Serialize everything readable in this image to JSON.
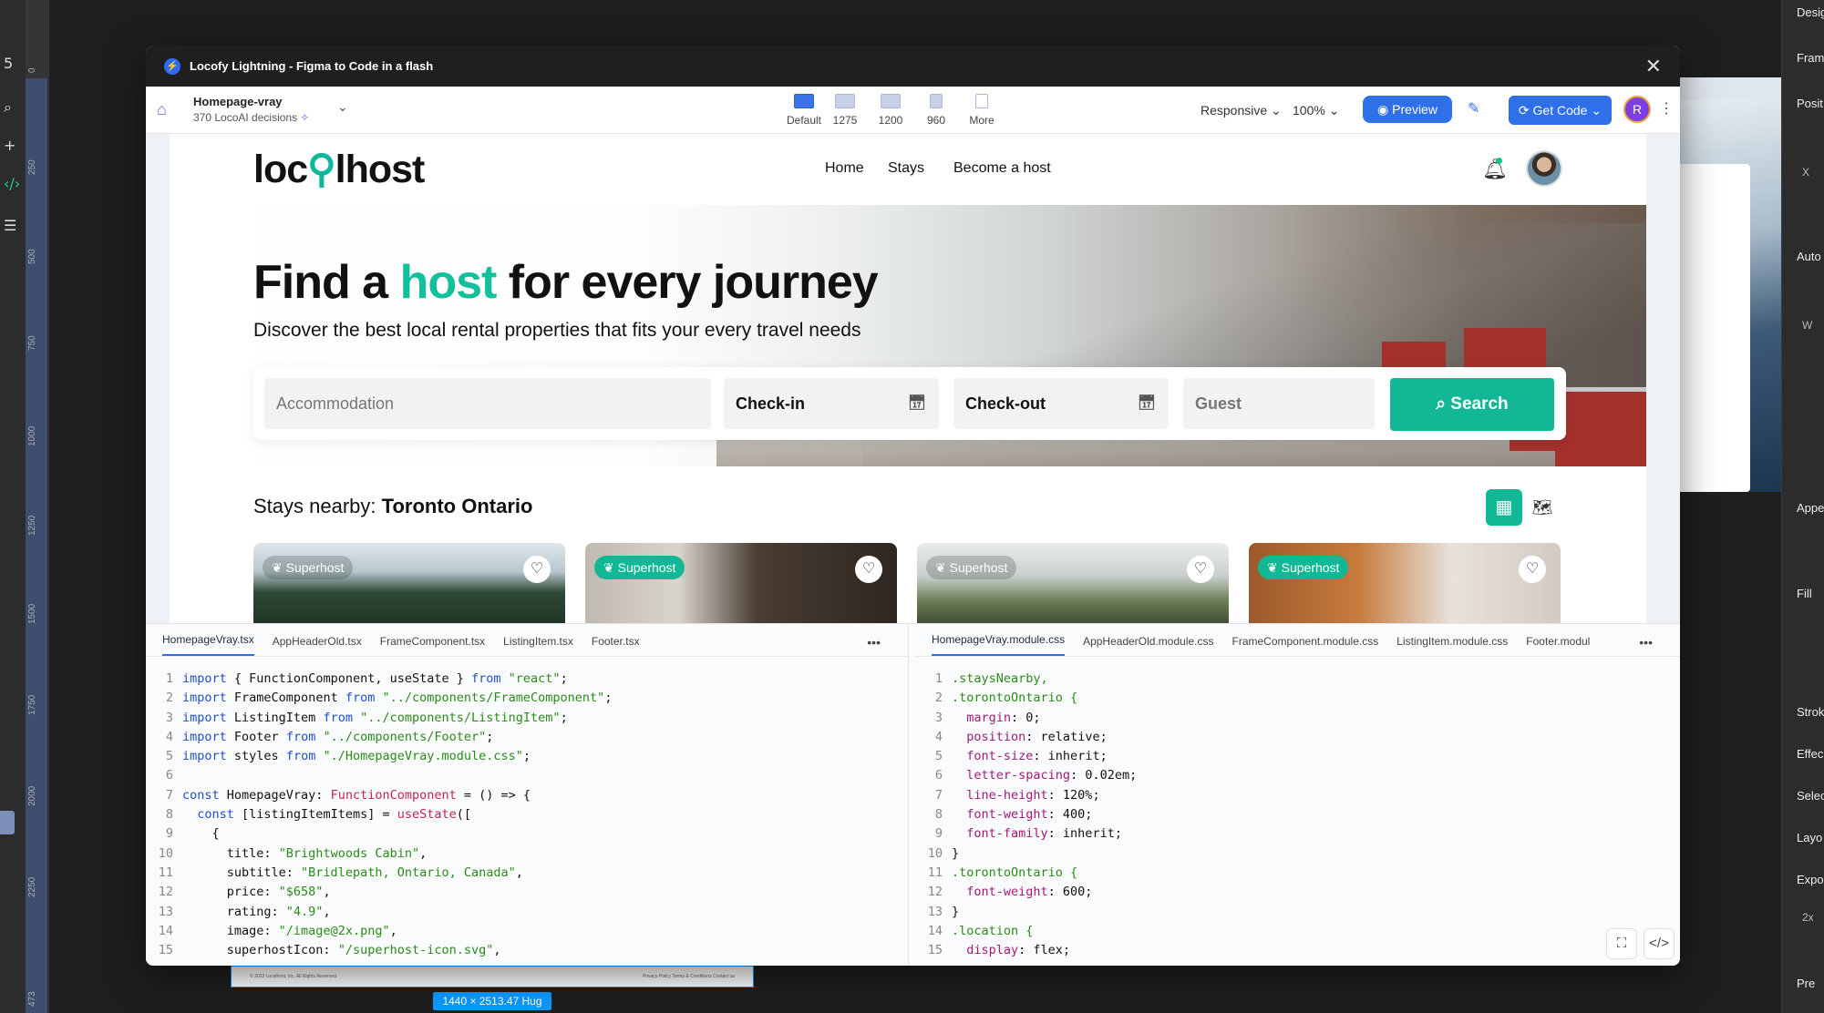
{
  "figma": {
    "ruler_marks": [
      "5",
      "0",
      "250",
      "500",
      "750",
      "1000",
      "1250",
      "1500",
      "1750",
      "2000",
      "2250",
      "473"
    ],
    "right_panel_labels": [
      "Desig",
      "Fram",
      "Posit",
      "Auto",
      "Appe",
      "Fill",
      "Strok",
      "Effec",
      "Selec",
      "Layo",
      "Expo",
      "Pre"
    ],
    "right_panel_values": [
      "X",
      "W",
      "2x"
    ],
    "frame_size": "1440 × 2513.47 Hug",
    "frame_footer_left": "© 2023 Localhost, Inc. All Rights Reserved",
    "frame_footer_links": "Privacy Policy   Terms & Conditions   Contact us"
  },
  "window": {
    "title": "Locofy Lightning - Figma to Code in a flash",
    "close_glyph": "✕"
  },
  "toolbar": {
    "project_name": "Homepage-vray",
    "project_sub": "370 LocoAI decisions",
    "breakpoints": [
      {
        "label": "Default",
        "active": true
      },
      {
        "label": "1275",
        "active": false
      },
      {
        "label": "1200",
        "active": false
      },
      {
        "label": "960",
        "active": false
      },
      {
        "label": "More",
        "active": false
      }
    ],
    "responsive_label": "Responsive",
    "zoom_label": "100%",
    "preview_label": "Preview",
    "get_code_label": "Get Code",
    "avatar_letter": "R",
    "accent_color": "#2f6fe9"
  },
  "site": {
    "logo_pre": "loc",
    "logo_post": "lhost",
    "nav": [
      "Home",
      "Stays",
      "Become a host"
    ],
    "hero_title_a": "Find a ",
    "hero_title_accent": "host",
    "hero_title_b": " for every journey",
    "hero_subtitle": "Discover the best local rental properties that fits your every travel needs",
    "search": {
      "accommodation_placeholder": "Accommodation",
      "checkin_label": "Check-in",
      "checkout_label": "Check-out",
      "guest_placeholder": "Guest",
      "button_label": "Search"
    },
    "stays_prefix": "Stays nearby: ",
    "stays_location": "Toronto Ontario",
    "badge_label": "Superhost",
    "accent_color": "#12b896"
  },
  "code_left": {
    "tabs": [
      "HomepageVray.tsx",
      "AppHeaderOld.tsx",
      "FrameComponent.tsx",
      "ListingItem.tsx",
      "Footer.tsx"
    ],
    "lines": [
      "import { FunctionComponent, useState } from \"react\";",
      "import FrameComponent from \"../components/FrameComponent\";",
      "import ListingItem from \"../components/ListingItem\";",
      "import Footer from \"../components/Footer\";",
      "import styles from \"./HomepageVray.module.css\";",
      "",
      "const HomepageVray: FunctionComponent = () => {",
      "  const [listingItemItems] = useState([",
      "    {",
      "      title: \"Brightwoods Cabin\",",
      "      subtitle: \"Bridlepath, Ontario, Canada\",",
      "      price: \"$658\",",
      "      rating: \"4.9\",",
      "      image: \"/image@2x.png\",",
      "      superhostIcon: \"/superhost-icon.svg\","
    ]
  },
  "code_right": {
    "tabs": [
      "HomepageVray.module.css",
      "AppHeaderOld.module.css",
      "FrameComponent.module.css",
      "ListingItem.module.css",
      "Footer.modul"
    ],
    "lines": [
      ".staysNearby,",
      ".torontoOntario {",
      "  margin: 0;",
      "  position: relative;",
      "  font-size: inherit;",
      "  letter-spacing: 0.02em;",
      "  line-height: 120%;",
      "  font-weight: 400;",
      "  font-family: inherit;",
      "}",
      ".torontoOntario {",
      "  font-weight: 600;",
      "}",
      ".location {",
      "  display: flex;"
    ]
  }
}
